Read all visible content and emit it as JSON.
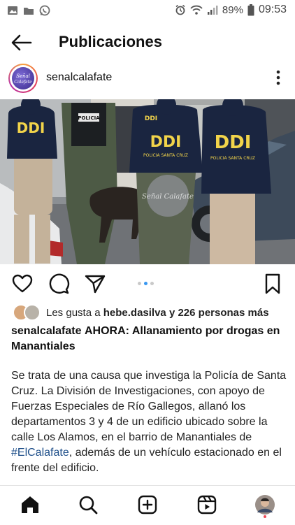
{
  "status_bar": {
    "battery": "89%",
    "time": "09:53"
  },
  "header": {
    "title": "Publicaciones"
  },
  "post": {
    "username": "senalcalafate",
    "avatar_text": "Señal Calafate",
    "photo": {
      "labels": [
        "DDI",
        "DDI",
        "DDI",
        "DDI"
      ],
      "vest_text": "POLICIA SANTA CRUZ",
      "patch": "POLICIA",
      "watermark": "Señal Calafate"
    },
    "carousel": {
      "count": 3,
      "active": 2
    },
    "likes": {
      "prefix": "Les gusta a ",
      "user": "hebe.dasilva",
      "suffix": " y 226 personas más"
    },
    "caption": {
      "username": "senalcalafate",
      "tag": "AHORA",
      "text": ": Allanamiento por drogas en Manantiales"
    },
    "body": {
      "before": "Se trata de una causa que investiga la Policía de Santa Cruz. La División de Investigaciones, con apoyo de Fuerzas Especiales de Río Gallegos, allanó los departamentos 3 y 4 de un edificio ubicado sobre la calle Los Alamos, en el barrio de Manantiales de ",
      "hashtag": "#ElCalafate",
      "after": ", además de un vehículo estacionado en el frente del edificio."
    }
  },
  "nav": [
    "home-icon",
    "search-icon",
    "create-icon",
    "reels-icon",
    "profile-avatar"
  ],
  "colors": {
    "link": "#1d4e89",
    "carousel_active": "#3897f0",
    "vest": "#1a2540",
    "ddi_text": "#f2d44a"
  }
}
